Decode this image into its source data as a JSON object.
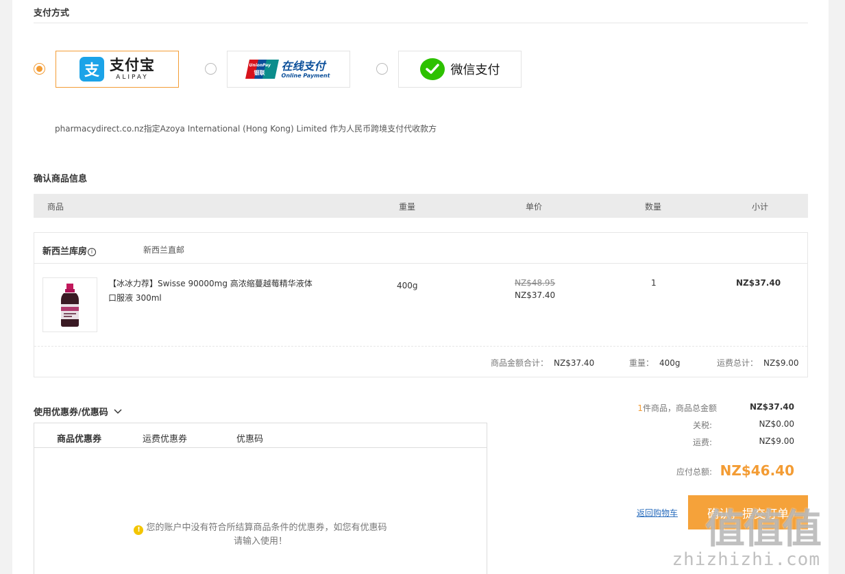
{
  "payment": {
    "title": "支付方式",
    "alipay": {
      "cn": "支付宝",
      "en": "ALIPAY",
      "mark": "支"
    },
    "unionpay": {
      "cn": "在线支付",
      "en": "Online Payment",
      "mark_top": "UnionPay",
      "mark_cn": "银联"
    },
    "wechat": {
      "cn": "微信支付"
    },
    "notice": "pharmacydirect.co.nz指定Azoya International (Hong Kong) Limited 作为人民币跨境支付代收款方"
  },
  "confirm": {
    "title": "确认商品信息",
    "headers": {
      "product": "商品",
      "weight": "重量",
      "price": "单价",
      "qty": "数量",
      "subtotal": "小计"
    },
    "warehouse": {
      "name": "新西兰库房",
      "info_mark": "i",
      "shipping": "新西兰直邮"
    },
    "item": {
      "name": "【冰冰力荐】Swisse 90000mg 高浓缩蔓越莓精华液体口服液 300ml",
      "weight": "400g",
      "original_price": "NZ$48.95",
      "price": "NZ$37.40",
      "qty": "1",
      "subtotal": "NZ$37.40"
    },
    "summary": {
      "goods_label": "商品金额合计：",
      "goods_value": "NZ$37.40",
      "weight_label": "重量：",
      "weight_value": "400g",
      "shipping_label": "运费总计：",
      "shipping_value": "NZ$9.00"
    }
  },
  "coupon": {
    "title": "使用优惠券/优惠码",
    "tabs": [
      "商品优惠券",
      "运费优惠券",
      "优惠码"
    ],
    "empty_line1": "您的账户中没有符合所结算商品条件的优惠券，如您有优惠码",
    "empty_line2": "请输入使用！",
    "warn_mark": "!"
  },
  "totals": {
    "count": "1",
    "count_label": "件商品，商品总金额",
    "goods_value": "NZ$37.40",
    "tax_label": "关税:",
    "tax_value": "NZ$0.00",
    "ship_label": "运费:",
    "ship_value": "NZ$9.00",
    "grand_label": "应付总额:",
    "grand_value": "NZ$46.40",
    "back_link": "返回购物车",
    "submit": "确认，提交订单"
  },
  "watermark": {
    "top": "值值值",
    "bottom": "zhizhizhi.com"
  },
  "colors": {
    "accent": "#f39c34",
    "alipay": "#1ba3e8",
    "wechat": "#2dc100",
    "link": "#2a6dbd"
  }
}
